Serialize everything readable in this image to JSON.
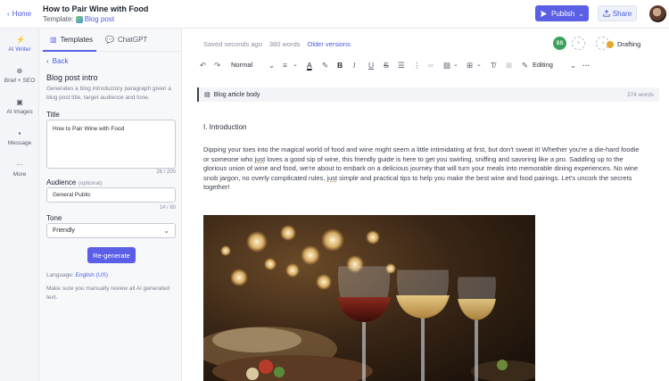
{
  "topbar": {
    "home_label": "Home",
    "doc_title": "How to Pair Wine with Food",
    "template_prefix": "Template:",
    "template_name": "Blog post",
    "publish_label": "Publish",
    "share_label": "Share"
  },
  "rail": {
    "items": [
      {
        "label": "AI Writer",
        "icon": "bolt-icon"
      },
      {
        "label": "Brief + SEO",
        "icon": "target-icon"
      },
      {
        "label": "AI Images",
        "icon": "image-icon"
      },
      {
        "label": "Message",
        "icon": "message-icon"
      },
      {
        "label": "More",
        "icon": "more-icon"
      }
    ]
  },
  "panel": {
    "tabs": [
      {
        "label": "Templates",
        "icon": "book-icon"
      },
      {
        "label": "ChatGPT",
        "icon": "chat-icon"
      }
    ],
    "back_label": "Back",
    "heading": "Blog post intro",
    "description": "Generates a blog introductory paragraph given a blog post title, target audience and tone.",
    "title_label": "Title",
    "title_value": "How to Pair Wine with Food",
    "title_counter": "26 / 200",
    "audience_label": "Audience",
    "audience_optional": "(optional)",
    "audience_value": "General Public",
    "audience_counter": "14 / 80",
    "tone_label": "Tone",
    "tone_value": "Friendly",
    "regenerate_label": "Re-generate",
    "language_prefix": "Language:",
    "language_value": "English (US)",
    "note": "Make sure you manually review all AI generated text."
  },
  "editor": {
    "saved_text": "Saved seconds ago",
    "word_count": "380 words",
    "older_versions": "Older versions",
    "collaborator_initials": "SS",
    "status": "Drafting",
    "status_color": "#e5a72c",
    "toolbar": {
      "paragraph_style": "Normal",
      "mode": "Editing"
    },
    "field_name": "Blog article body",
    "field_word_count": "374 words",
    "intro_heading": "I. Introduction",
    "paragraph_before_just1": "Dipping your toes into the magical world of food and wine might seem a little intimidating at first, but don't sweat it! Whether you're a die-hard foodie or someone who ",
    "just": "just",
    "paragraph_middle": " loves a good sip of wine, this friendly guide is here to get you swirling, sniffing and savoring like a pro. Saddling up to the glorious union of wine and food, we're about to embark on a delicious journey that will turn your meals into memorable dining experiences. No wine snob jargon, no overly complicated rules, ",
    "paragraph_end": " simple and practical tips to help you make the best wine and food pairings. Let's uncork the secrets together!"
  },
  "colors": {
    "accent": "#5b5fe6",
    "link": "#4b5bdc",
    "collaborator": "#3aa25a"
  }
}
